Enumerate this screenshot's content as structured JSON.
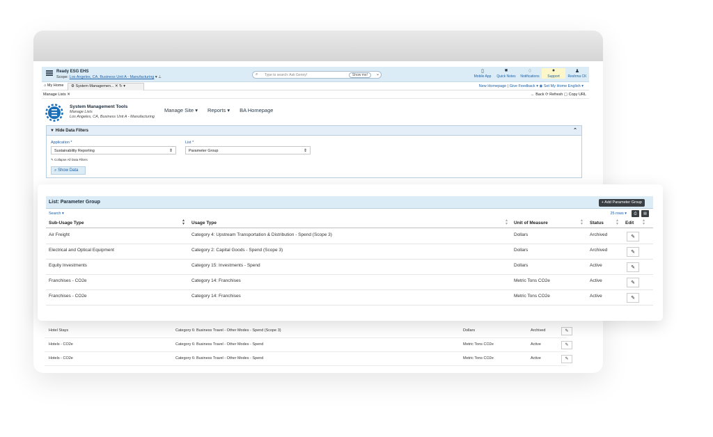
{
  "app": {
    "brand_title": "Ready ESG EHS",
    "scope_label": "Scope:",
    "scope_value": "Los Angeles, CA, Business Unit A - Manufacturing",
    "search_placeholder": "Type to search: Ask Genny!",
    "show_me": "Show me!",
    "toolbar": [
      {
        "label": "Mobile App",
        "icon": "mobile-icon"
      },
      {
        "label": "Quick Notes",
        "icon": "notes-icon"
      },
      {
        "label": "Notifications",
        "icon": "bell-icon"
      },
      {
        "label": "Support",
        "icon": "info-icon"
      },
      {
        "label": "Reshma CK",
        "icon": "user-icon"
      }
    ]
  },
  "tabs": {
    "home": "My Home",
    "active": "System Managemen...",
    "right": "New Homepage | Give Feedback ▾     ◉ Set My Home     English ▾"
  },
  "crumb": {
    "current": "Manage Lists",
    "actions": "← Back   ⟳ Refresh   ▢ Copy URL"
  },
  "page": {
    "title": "System Management Tools",
    "subtitle": "Manage Lists",
    "location": "Los Angeles, CA, Business Unit A - Manufacturing",
    "nav": [
      "Manage Site ▾",
      "Reports ▾",
      "BA Homepage"
    ]
  },
  "filters": {
    "header": "Hide Data Filters",
    "application_label": "Application *",
    "application_value": "Sustainability Reporting",
    "list_label": "List *",
    "list_value": "Parameter Group",
    "collapse": "Collapse All Data Filters",
    "show_data": "Show Data"
  },
  "list": {
    "title": "List: Parameter Group",
    "add_button": "+ Add Parameter Group",
    "search_link": "Search ▾",
    "rows_select": "25 rows ▾",
    "columns": [
      "Sub-Usage Type",
      "Usage Type",
      "Unit of Measure",
      "Status",
      "Edit"
    ],
    "rows": [
      {
        "sub": "Air Freight",
        "usage": "Category 4: Upstream Transportation & Distribution - Spend (Scope 3)",
        "unit": "Dollars",
        "status": "Archived"
      },
      {
        "sub": "Electrical and Optical Equipment",
        "usage": "Category 2: Capital Goods - Spend (Scope 3)",
        "unit": "Dollars",
        "status": "Archived"
      },
      {
        "sub": "Equity Investments",
        "usage": "Category 15: Investments - Spend",
        "unit": "Dollars",
        "status": "Active"
      },
      {
        "sub": "Franchises - CO2e",
        "usage": "Category 14: Franchises",
        "unit": "Metric Tons CO2e",
        "status": "Active"
      },
      {
        "sub": "Franchises - CO2e",
        "usage": "Category 14: Franchises",
        "unit": "Metric Tons CO2e",
        "status": "Active"
      }
    ],
    "back_rows": [
      {
        "sub": "Hotel Stays",
        "usage": "Category 6: Business Travel - Other Modes - Spend (Scope 3)",
        "unit": "Dollars",
        "status": "Archived"
      },
      {
        "sub": "Hotels - CO2e",
        "usage": "Category 6: Business Travel - Other Modes - Spend",
        "unit": "Metric Tons CO2e",
        "status": "Active"
      },
      {
        "sub": "Hotels - CO2e",
        "usage": "Category 6: Business Travel - Other Modes - Spend",
        "unit": "Metric Tons CO2e",
        "status": "Active"
      }
    ]
  }
}
